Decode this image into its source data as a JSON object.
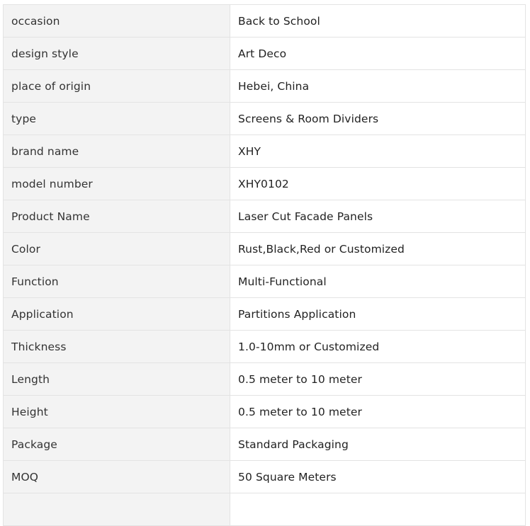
{
  "specs": [
    {
      "label": "occasion",
      "value": "Back to School"
    },
    {
      "label": "design style",
      "value": "Art Deco"
    },
    {
      "label": "place of origin",
      "value": "Hebei, China"
    },
    {
      "label": "type",
      "value": "Screens & Room Dividers"
    },
    {
      "label": "brand name",
      "value": "XHY"
    },
    {
      "label": "model number",
      "value": "XHY0102"
    },
    {
      "label": "Product Name",
      "value": "Laser Cut Facade Panels"
    },
    {
      "label": "Color",
      "value": "Rust,Black,Red or Customized"
    },
    {
      "label": "Function",
      "value": "Multi-Functional"
    },
    {
      "label": "Application",
      "value": "Partitions Application"
    },
    {
      "label": "Thickness",
      "value": "1.0-10mm or Customized"
    },
    {
      "label": "Length",
      "value": "0.5 meter to 10 meter"
    },
    {
      "label": "Height",
      "value": "0.5 meter to 10 meter"
    },
    {
      "label": "Package",
      "value": "Standard Packaging"
    },
    {
      "label": "MOQ",
      "value": "50 Square Meters"
    },
    {
      "label": "",
      "value": ""
    }
  ]
}
